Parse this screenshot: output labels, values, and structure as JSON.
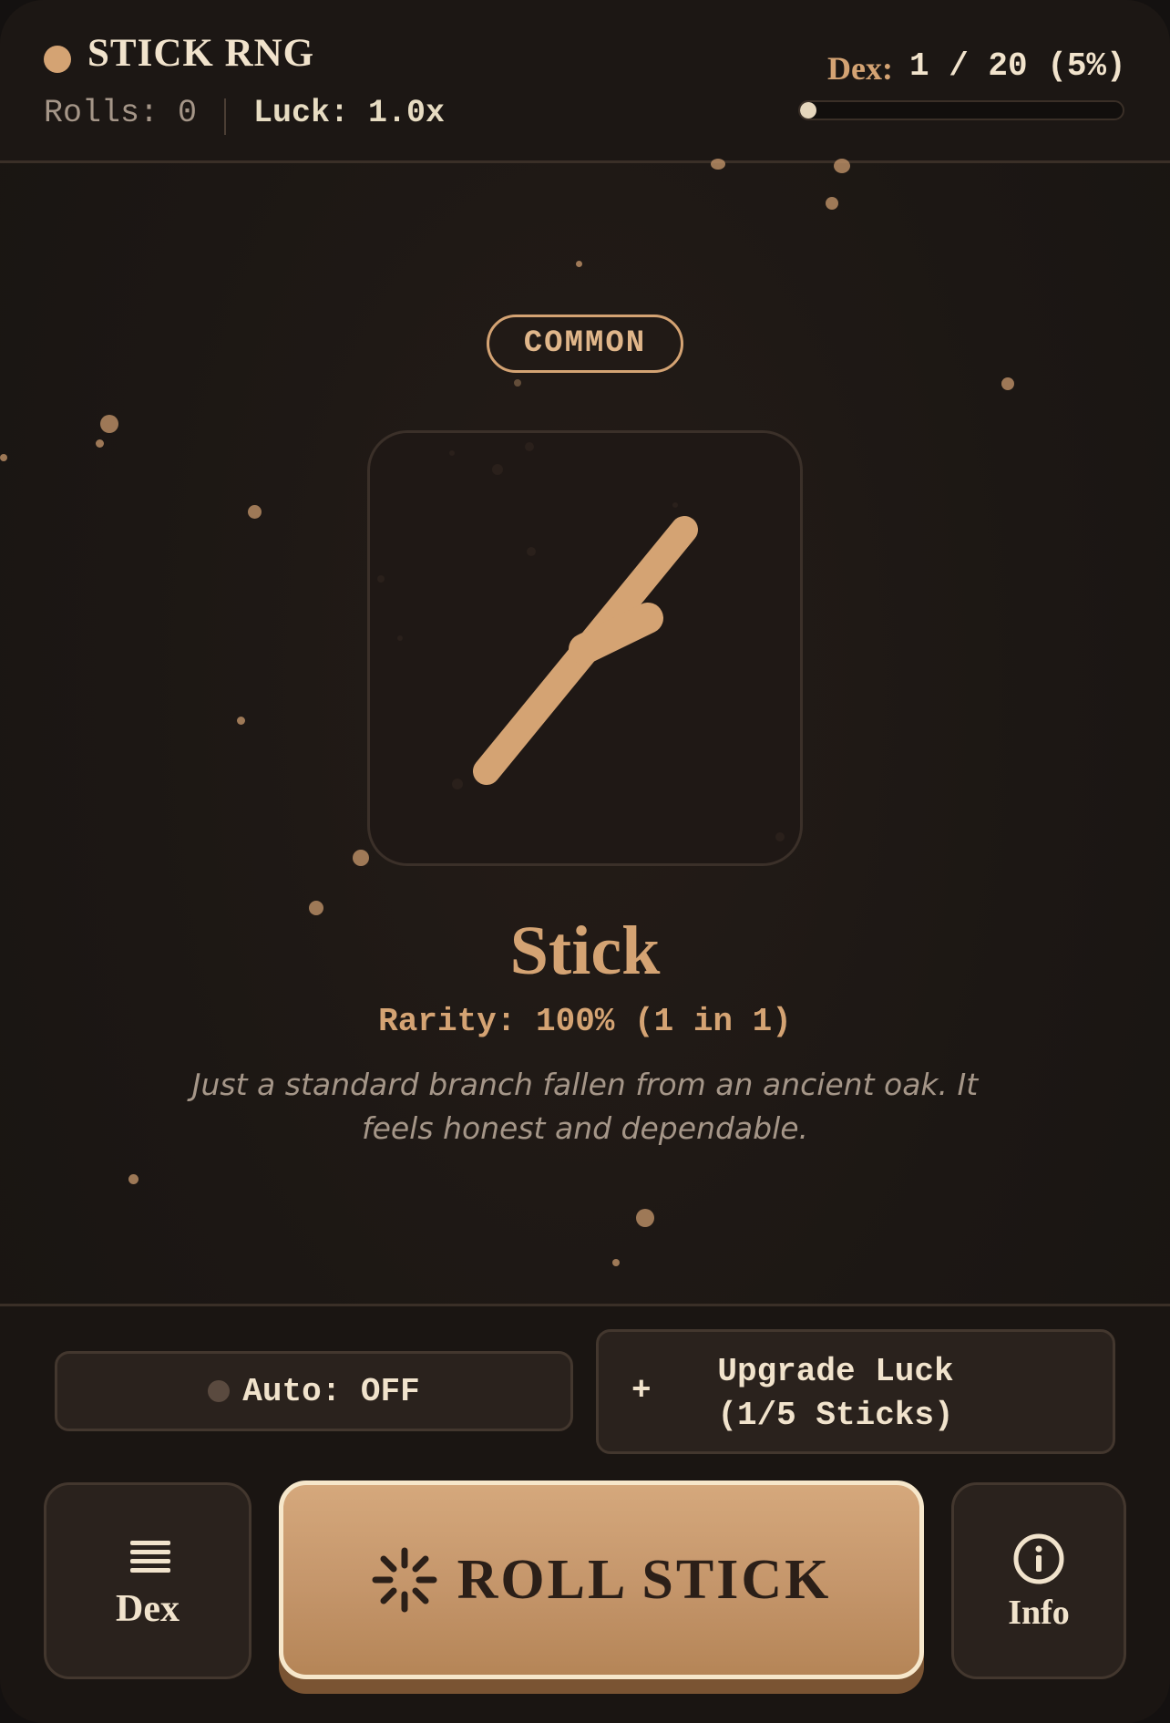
{
  "header": {
    "title": "STICK RNG",
    "rolls": "Rolls: 0",
    "luck": "Luck: 1.0x",
    "dex_label": "Dex:",
    "dex_value": "1 / 20 (5%)",
    "dex_progress": 0.05
  },
  "item": {
    "rarity_badge": "COMMON",
    "name": "Stick",
    "rarity_text": "Rarity: 100% (1 in 1)",
    "description": "Just a standard branch fallen from an ancient oak. It feels honest and dependable.",
    "icon": "stick-icon"
  },
  "controls": {
    "auto_label": "Auto: OFF",
    "upgrade_plus": "+",
    "upgrade_label": "Upgrade Luck (1/5 Sticks)",
    "dex_button": "Dex",
    "roll_button": "ROLL STICK",
    "info_button": "Info"
  },
  "colors": {
    "accent": "#d4a373",
    "background": "#1c1714",
    "text": "#f1e3cc"
  }
}
